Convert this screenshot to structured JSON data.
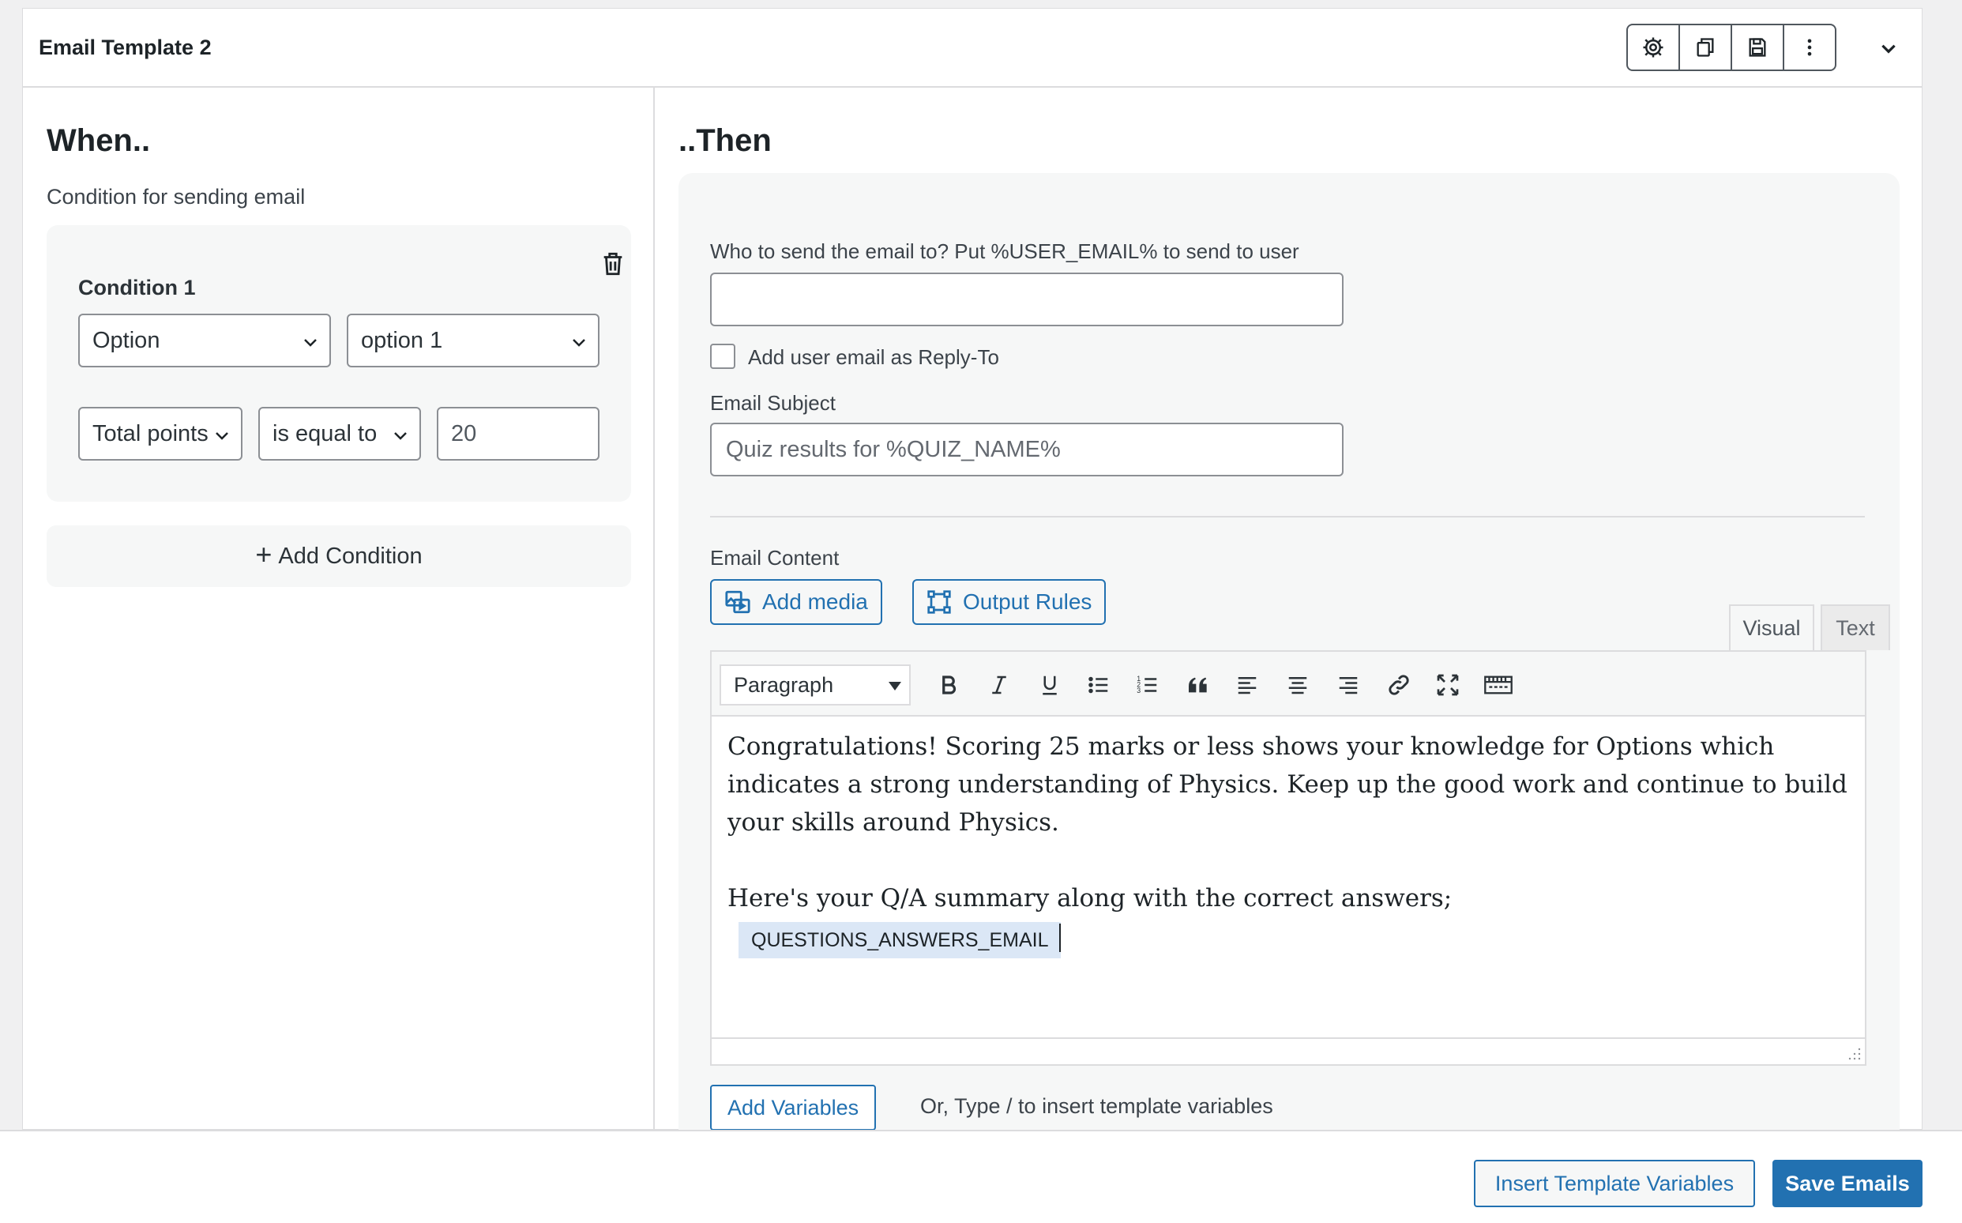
{
  "template": {
    "title": "Email Template 2",
    "toolbar_icons": [
      "gear-icon",
      "copy-icon",
      "save-icon",
      "more-vertical-icon"
    ],
    "collapse_icon": "chevron-down-icon"
  },
  "when": {
    "heading": "When..",
    "subtitle": "Condition for sending email",
    "conditions": [
      {
        "title": "Condition 1",
        "type_select": "Option",
        "value_select": "option 1",
        "metric_select": "Total points",
        "operator_select": "is equal to",
        "number_value": "20"
      }
    ],
    "add_condition_label": "Add Condition"
  },
  "then": {
    "heading": "..Then",
    "recipient_label": "Who to send the email to? Put %USER_EMAIL% to send to user",
    "recipient_value": "",
    "reply_to_label": "Add user email as Reply-To",
    "reply_to_checked": false,
    "subject_label": "Email Subject",
    "subject_placeholder": "Quiz results for %QUIZ_NAME%",
    "content_label": "Email Content",
    "add_media_label": "Add media",
    "output_rules_label": "Output Rules",
    "tab_visual": "Visual",
    "tab_text": "Text",
    "format_select": "Paragraph",
    "editor_paragraph_1": "Congratulations! Scoring 25 marks or less shows your knowledge for Options which indicates a strong understanding of Physics. Keep up the good work and continue to build your skills around Physics.",
    "editor_paragraph_2": "Here's your Q/A summary along with the correct answers;",
    "editor_variable_chip": "QUESTIONS_ANSWERS_EMAIL",
    "add_variables_label": "Add Variables",
    "variables_hint": "Or, Type / to insert template variables"
  },
  "footer": {
    "insert_variables_label": "Insert Template Variables",
    "save_label": "Save Emails"
  },
  "colors": {
    "accent": "#2271b1",
    "panel_bg": "#f6f7f7",
    "chip_bg": "#dbe7f6"
  }
}
